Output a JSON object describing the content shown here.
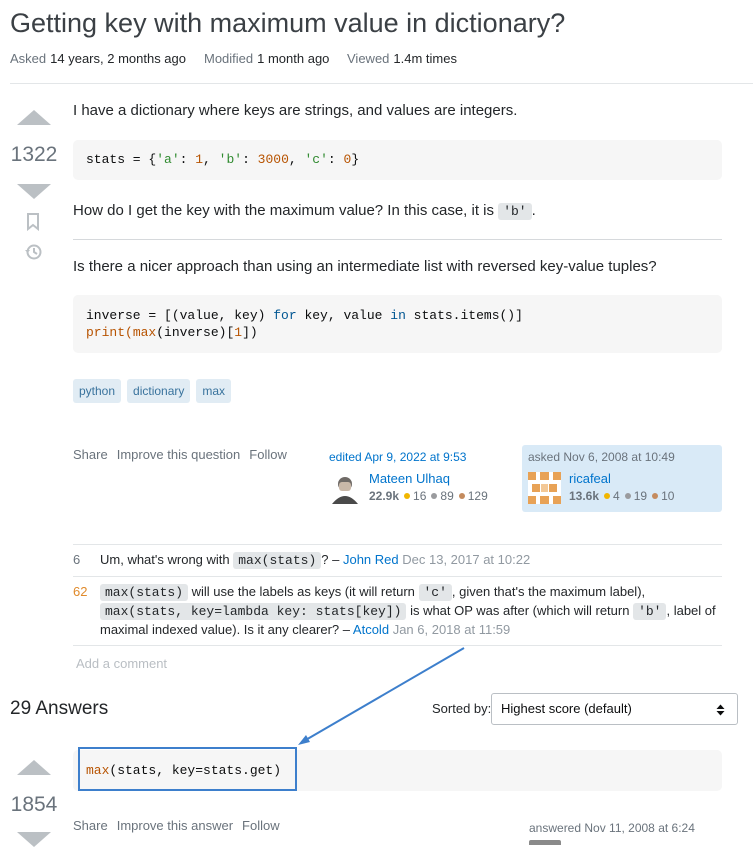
{
  "question": {
    "title": "Getting key with maximum value in dictionary?",
    "meta": {
      "asked_label": "Asked",
      "asked_value": "14 years, 2 months ago",
      "modified_label": "Modified",
      "modified_value": "1 month ago",
      "viewed_label": "Viewed",
      "viewed_value": "1.4m times"
    },
    "score": "1322",
    "body": {
      "p1": "I have a dictionary where keys are strings, and values are integers.",
      "code1": {
        "var": "stats = {",
        "k1": "'a'",
        "sep1": ": ",
        "v1": "1",
        "c1": ", ",
        "k2": "'b'",
        "sep2": ": ",
        "v2": "3000",
        "c2": ", ",
        "k3": "'c'",
        "sep3": ": ",
        "v3": "0",
        "end": "}"
      },
      "p2_before": "How do I get the key with the maximum value? In this case, it is ",
      "p2_code": "'b'",
      "p2_after": ".",
      "p3": "Is there a nicer approach than using an intermediate list with reversed key-value tuples?",
      "code2": {
        "l1a": "inverse = [(value, key) ",
        "l1_for": "for",
        "l1b": " key, value ",
        "l1_in": "in",
        "l1c": " stats.items()]",
        "l2_print": "print",
        "l2a": "(",
        "l2_max": "max",
        "l2b": "(inverse)[",
        "l2_one": "1",
        "l2c": "])"
      }
    },
    "tags": [
      "python",
      "dictionary",
      "max"
    ],
    "actions": {
      "share": "Share",
      "improve": "Improve this question",
      "follow": "Follow"
    },
    "editor": {
      "time": "edited Apr 9, 2022 at 9:53",
      "name": "Mateen Ulhaq",
      "rep": "22.9k",
      "gold": "16",
      "silver": "89",
      "bronze": "129"
    },
    "asker": {
      "time": "asked Nov 6, 2008 at 10:49",
      "name": "ricafeal",
      "rep": "13.6k",
      "gold": "4",
      "silver": "19",
      "bronze": "10"
    }
  },
  "comments": [
    {
      "score": "6",
      "t1": "Um, what's wrong with ",
      "code1": "max(stats)",
      "t2": "? –",
      "author": "John Red",
      "date": "Dec 13, 2017 at 10:22"
    },
    {
      "score": "62",
      "code1": "max(stats)",
      "t1": " will use the labels as keys (it will return ",
      "code2": "'c'",
      "t2": ", given that's the maximum label),",
      "code3": "max(stats, key=lambda key: stats[key])",
      "t3": " is what OP was after (which will return ",
      "code4": "'b'",
      "t4": ", label of",
      "t5": "maximal indexed value). Is it any clearer? –",
      "author": "Atcold",
      "date": "Jan 6, 2018 at 11:59"
    }
  ],
  "add_comment": "Add a comment",
  "answers_header": {
    "count": "29 Answers",
    "sorted_label": "Sorted by:",
    "sort_value": "Highest score (default)"
  },
  "answer": {
    "score": "1854",
    "code": {
      "fn": "max",
      "rest": "(stats, key=stats.get)"
    },
    "actions": {
      "share": "Share",
      "improve": "Improve this answer",
      "follow": "Follow"
    },
    "answered": "answered Nov 11, 2008 at 6:24"
  },
  "colors": {
    "link": "#0074cc",
    "tag_bg": "#e1ecf4",
    "tag_fg": "#39739d",
    "annotation": "#3d7fcc",
    "gold": "#f1b600",
    "silver": "#9a9b9e",
    "bronze": "#c48b5e"
  }
}
